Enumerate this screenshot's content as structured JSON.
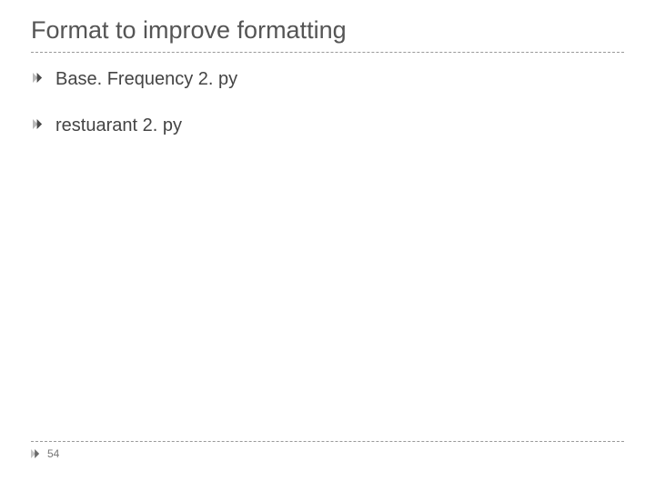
{
  "title": "Format to improve formatting",
  "bullets": [
    {
      "text": "Base. Frequency 2. py"
    },
    {
      "text": "restuarant 2. py"
    }
  ],
  "footer": {
    "page_number": "54"
  }
}
